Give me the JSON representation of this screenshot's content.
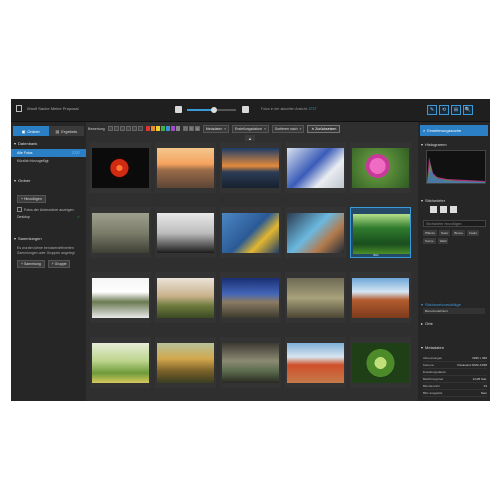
{
  "titlebar": {
    "title": "Woolf Sache Meine Proposal",
    "count_text": "Fotos in der aktuellen Ansicht:",
    "count_value": "2727",
    "buttons": [
      "✎",
      "⟲",
      "⊞",
      "🔍"
    ],
    "zoom_level_fraction": 0.55
  },
  "left": {
    "tab_folders": "Ordner",
    "tab_results": "Ergebnis",
    "sec_database": "Datenbank",
    "rows": [
      {
        "label": "Alle Fotos",
        "count": "2727"
      },
      {
        "label": "Kürzlich hinzugefügt",
        "count": ""
      }
    ],
    "sec_folder": "Ordner",
    "add_btn": "Hinzufügen",
    "include_sub": "Fotos der Unterordner anzeigen",
    "desktop": "Desktop",
    "sec_collections": "Sammlungen",
    "coll_note": "Es wurden keine benutzerdefinierten Sammlungen oder Gruppen angelegt",
    "coll_btn": "Sammlung",
    "group_btn": "Gruppe"
  },
  "toolbar": {
    "rating_label": "Bewertung",
    "metadata": "Metadaten",
    "date": "Erstellungsdatum",
    "sort": "Sortieren nach",
    "reset": "Zurücksetzen",
    "label_colors": [
      "#d33",
      "#e98b2a",
      "#e8d22c",
      "#3fae49",
      "#3a8fd9",
      "#9a4dc9",
      "#888"
    ],
    "view_icons": [
      "⊟",
      "⊞",
      "⊠"
    ]
  },
  "grid_label": "▲",
  "right": {
    "top_title": "Erweiterungssuche",
    "histo_title": "Histogramm",
    "kw_title": "Stichwörter",
    "kw_placeholder": "Stichwörter hinzufügen",
    "tags": [
      "Pflanze",
      "Natur",
      "Blume",
      "Insekt",
      "Sonne",
      "Wald"
    ],
    "kw_label_title": "Stichwortvorschläge",
    "vp_item": "Benutzerdefiniert",
    "other_item": "Orte",
    "meta_title": "Metadaten",
    "meta": [
      {
        "k": "Abmessungen",
        "v": "3396 x 360"
      },
      {
        "k": "Kamera",
        "v": "Panasonic DMC-FZ38"
      },
      {
        "k": "Erstellungsdatum",
        "v": ""
      },
      {
        "k": "Belichtungszeit",
        "v": "1/125 Sek."
      },
      {
        "k": "Blendenzahl",
        "v": "f/4"
      },
      {
        "k": "Blitz ausgelöst",
        "v": "Nein"
      }
    ]
  },
  "thumbs": [
    {
      "name": "red-sun",
      "label": ""
    },
    {
      "name": "rail-sunset",
      "label": ""
    },
    {
      "name": "boat-harbor",
      "label": ""
    },
    {
      "name": "motorbike",
      "label": ""
    },
    {
      "name": "pink-flower",
      "label": ""
    },
    {
      "name": "statue",
      "label": ""
    },
    {
      "name": "brushes",
      "label": ""
    },
    {
      "name": "cleaning-hand",
      "label": ""
    },
    {
      "name": "tablet-hand",
      "label": ""
    },
    {
      "name": "forest",
      "label": "IMG"
    },
    {
      "name": "money-box",
      "label": ""
    },
    {
      "name": "mountain-dusk",
      "label": ""
    },
    {
      "name": "mountain-lake",
      "label": ""
    },
    {
      "name": "factory",
      "label": ""
    },
    {
      "name": "field-road",
      "label": ""
    },
    {
      "name": "flowers-field",
      "label": ""
    },
    {
      "name": "owl",
      "label": ""
    },
    {
      "name": "bird",
      "label": ""
    },
    {
      "name": "red-cliffs",
      "label": ""
    },
    {
      "name": "green-plant",
      "label": ""
    }
  ]
}
